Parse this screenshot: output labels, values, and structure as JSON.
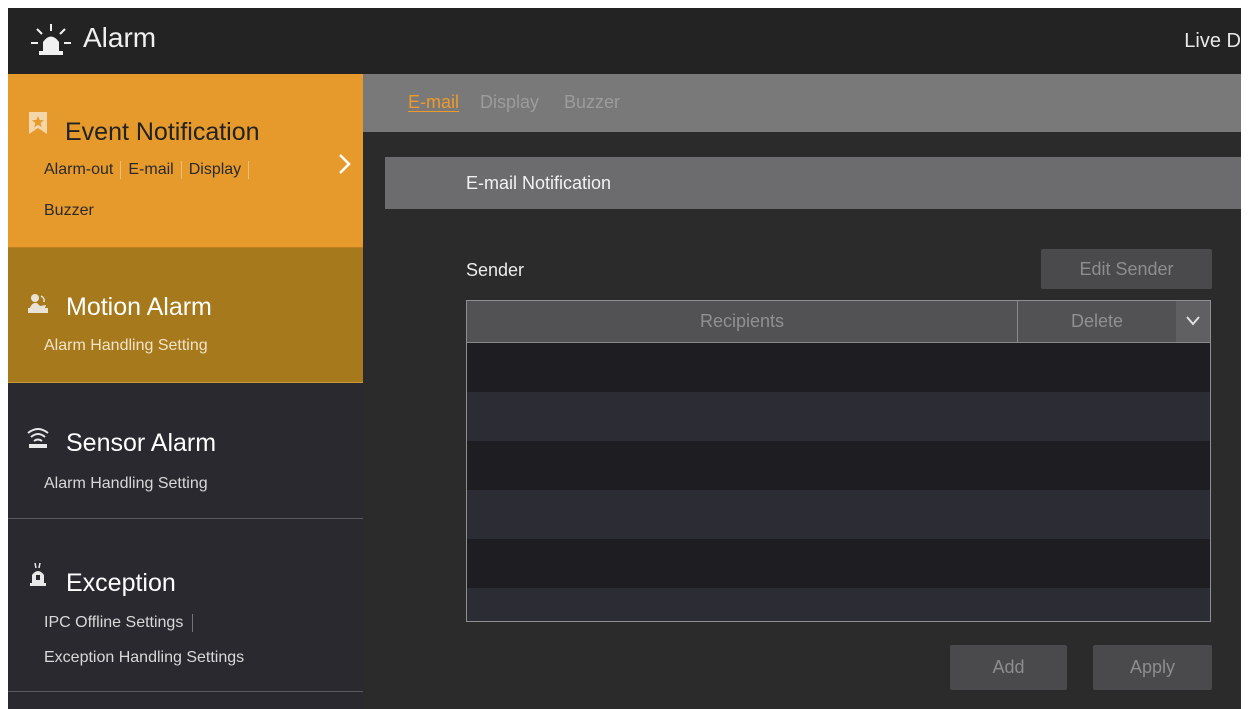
{
  "header": {
    "title": "Alarm",
    "live_display_label": "Live D",
    "logo_icon": "alarm-siren-icon"
  },
  "sidebar": {
    "items": [
      {
        "title": "Event Notification",
        "icon": "bookmark-star-icon",
        "links": [
          "Alarm-out",
          "E-mail",
          "Display",
          "Buzzer"
        ],
        "state": "active",
        "color": "#e79a2c"
      },
      {
        "title": "Motion Alarm",
        "icon": "motion-person-icon",
        "sub": "Alarm Handling Setting",
        "color": "#a7791d"
      },
      {
        "title": "Sensor Alarm",
        "icon": "sensor-wave-icon",
        "sub": "Alarm Handling Setting"
      },
      {
        "title": "Exception",
        "icon": "exception-siren-icon",
        "links": [
          "IPC Offline Settings",
          "Exception Handling Settings"
        ]
      }
    ]
  },
  "tabs": [
    {
      "label": "E-mail",
      "active": true
    },
    {
      "label": "Display",
      "active": false
    },
    {
      "label": "Buzzer",
      "active": false
    }
  ],
  "email": {
    "section_title": "E-mail Notification",
    "sender_label": "Sender",
    "edit_sender_button": "Edit Sender",
    "table": {
      "columns": [
        "Recipients",
        "Delete"
      ],
      "rows": []
    },
    "add_button": "Add",
    "apply_button": "Apply"
  },
  "colors": {
    "accent": "#ee9a2a",
    "background": "#2b2b2c",
    "header": "#232324"
  }
}
